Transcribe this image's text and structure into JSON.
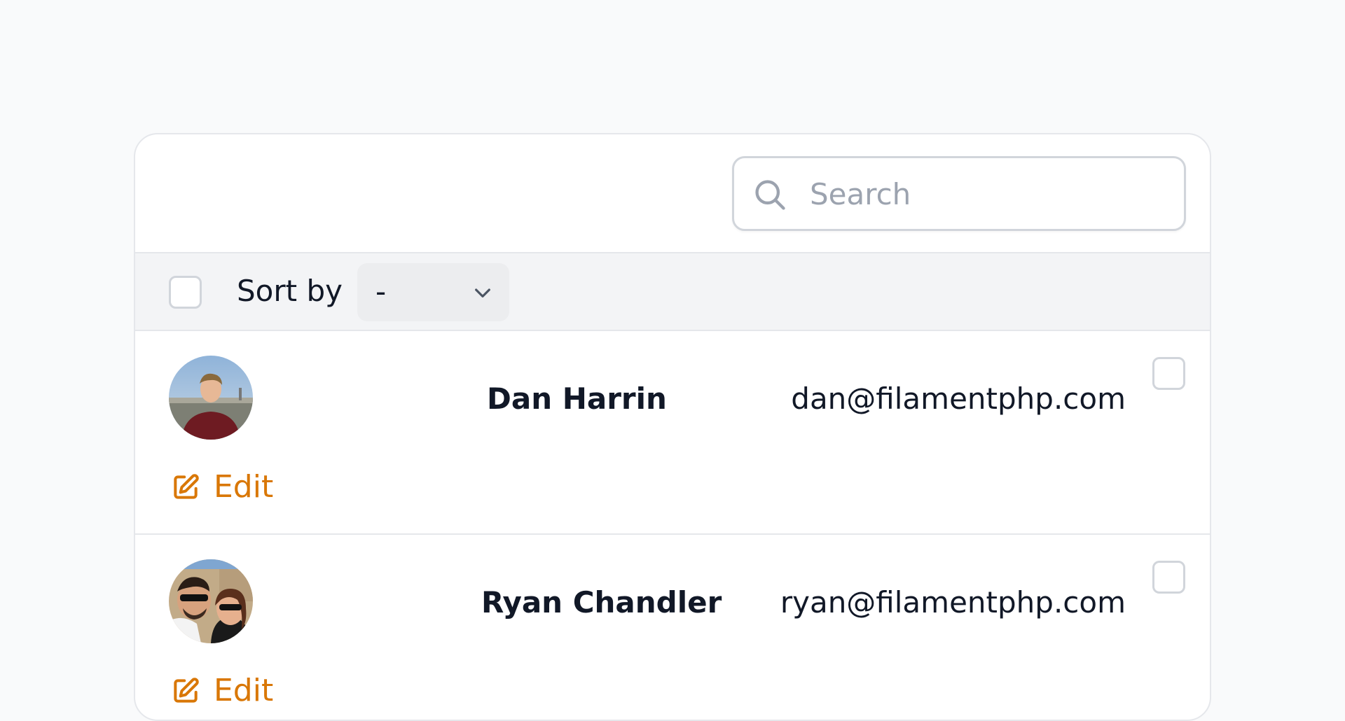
{
  "search": {
    "placeholder": "Search",
    "value": ""
  },
  "sort": {
    "label": "Sort by",
    "selected": "-"
  },
  "rows": [
    {
      "name": "Dan Harrin",
      "email": "dan@filamentphp.com",
      "action": "Edit"
    },
    {
      "name": "Ryan Chandler",
      "email": "ryan@filamentphp.com",
      "action": "Edit"
    }
  ],
  "icons": {
    "search": "search-icon",
    "select": "chevron-down-icon",
    "edit": "edit-icon"
  },
  "colors": {
    "accent": "#d97706",
    "background": "#f9fafb"
  }
}
